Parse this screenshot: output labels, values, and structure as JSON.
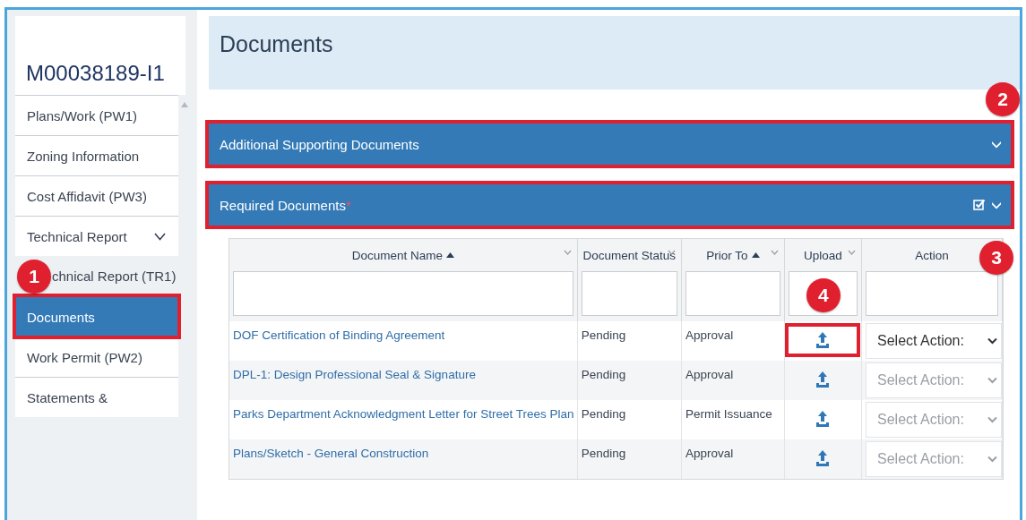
{
  "record_id": "M00038189-I1",
  "sidebar": {
    "items": [
      {
        "label": "Plans/Work (PW1)",
        "selected": false,
        "highlighted": false
      },
      {
        "label": "Zoning Information",
        "selected": false,
        "highlighted": false
      },
      {
        "label": "Cost Affidavit (PW3)",
        "selected": false,
        "highlighted": false
      },
      {
        "label": "Technical Report",
        "selected": false,
        "highlighted": false,
        "expanded": true,
        "children": [
          {
            "label": "chnical Report (TR1)",
            "selected": false,
            "highlighted": false,
            "callout": "1"
          }
        ]
      },
      {
        "label": "Documents",
        "selected": true,
        "highlighted": true
      },
      {
        "label": "Work Permit (PW2)",
        "selected": false,
        "highlighted": false
      },
      {
        "label": "Statements &",
        "selected": false,
        "highlighted": false
      }
    ]
  },
  "page_title": "Documents",
  "panels": [
    {
      "title": "Additional Supporting Documents",
      "highlighted": true,
      "checked": false,
      "callout": "2"
    },
    {
      "title": "Required Documents",
      "required_mark": "*",
      "highlighted": true,
      "checked": true
    }
  ],
  "table": {
    "callout": "3",
    "columns": [
      {
        "label": "Document Name",
        "sorted_ascending": true,
        "menu": true
      },
      {
        "label": "Document Status",
        "sorted_ascending": false,
        "menu": true
      },
      {
        "label": "Prior To",
        "sorted_ascending": true,
        "menu": true
      },
      {
        "label": "Upload",
        "sorted_ascending": false,
        "menu": true
      },
      {
        "label": "Action",
        "sorted_ascending": false,
        "menu": false
      }
    ],
    "rows": [
      {
        "document_name": "DOF Certification of Binding Agreement",
        "document_status": "Pending",
        "prior_to": "Approval",
        "upload_highlighted": true,
        "upload_callout": "4",
        "action": "Select Action:",
        "action_disabled": false
      },
      {
        "document_name": "DPL-1: Design Professional Seal & Signature",
        "document_status": "Pending",
        "prior_to": "Approval",
        "upload_highlighted": false,
        "action": "Select Action:",
        "action_disabled": true
      },
      {
        "document_name": "Parks Department Acknowledgment Letter for Street Trees Plan",
        "document_status": "Pending",
        "prior_to": "Permit Issuance",
        "upload_highlighted": false,
        "action": "Select Action:",
        "action_disabled": true
      },
      {
        "document_name": "Plans/Sketch - General Construction",
        "document_status": "Pending",
        "prior_to": "Approval",
        "upload_highlighted": false,
        "action": "Select Action:",
        "action_disabled": true
      }
    ]
  }
}
